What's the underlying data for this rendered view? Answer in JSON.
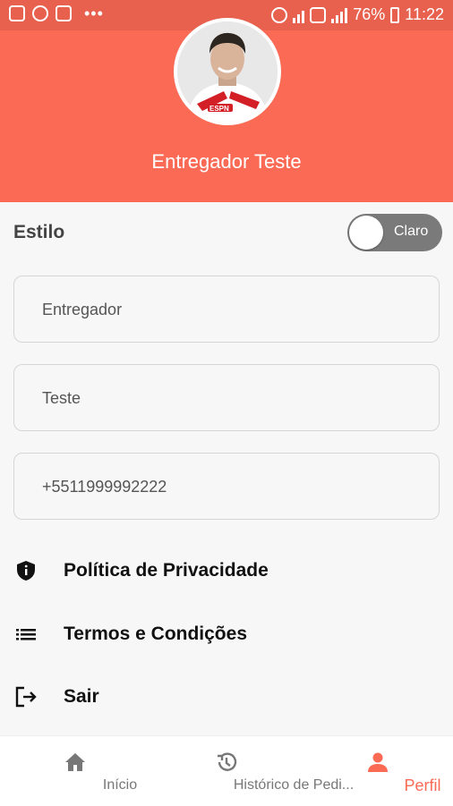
{
  "statusbar": {
    "battery": "76%",
    "time": "11:22"
  },
  "profile": {
    "name": "Entregador Teste"
  },
  "style": {
    "label": "Estilo",
    "toggle_text": "Claro"
  },
  "fields": {
    "first_name": "Entregador",
    "last_name": "Teste",
    "phone": "+5511999992222"
  },
  "menu": {
    "privacy": "Política de Privacidade",
    "terms": "Termos e Condições",
    "logout": "Sair"
  },
  "nav": {
    "home": "Início",
    "history": "Histórico de Pedi...",
    "profile": "Perfil"
  },
  "colors": {
    "accent": "#fb6a55"
  }
}
